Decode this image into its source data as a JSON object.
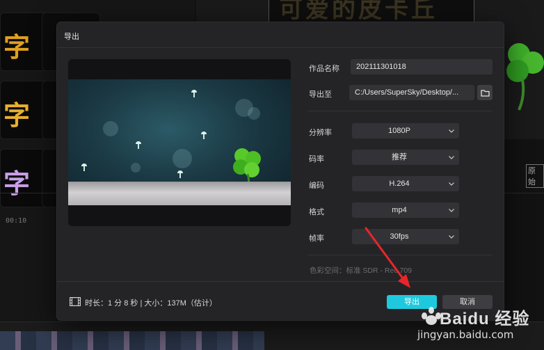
{
  "dialog": {
    "title": "导出",
    "fields": {
      "name_label": "作品名称",
      "name_value": "202111301018",
      "path_label": "导出至",
      "path_value": "C:/Users/SuperSky/Desktop/..."
    },
    "settings": [
      {
        "label": "分辨率",
        "value": "1080P"
      },
      {
        "label": "码率",
        "value": "推荐"
      },
      {
        "label": "编码",
        "value": "H.264"
      },
      {
        "label": "格式",
        "value": "mp4"
      },
      {
        "label": "帧率",
        "value": "30fps"
      }
    ],
    "color_space": "色彩空间：标准 SDR - Rec.709",
    "footer": {
      "duration_size": "时长：1 分 8 秒 | 大小：137M（估计）",
      "export_button": "导出",
      "cancel_button": "取消"
    }
  },
  "background": {
    "time_marker": "00:10",
    "title_text": "可爱的皮卡丘",
    "original_label": "原始",
    "tile_glyphs": [
      "字",
      "字",
      "字"
    ]
  },
  "watermark": {
    "line1": "Baidu 经验",
    "line2": "jingyan.baidu.com"
  },
  "colors": {
    "accent": "#1fc9dd",
    "dialog_bg": "#242427",
    "annotation_arrow": "#e8262a"
  },
  "icons": {
    "folder": "folder-icon",
    "film": "film-icon",
    "chevron": "chevron-down-icon"
  }
}
